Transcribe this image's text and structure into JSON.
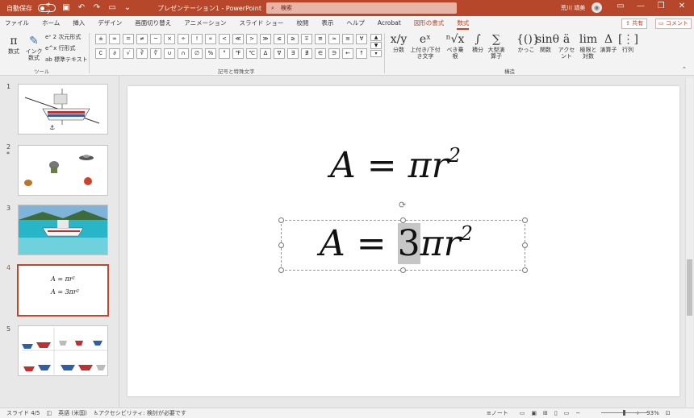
{
  "titlebar": {
    "autosave_label": "自動保存",
    "autosave_state": "オフ",
    "doc_title": "プレゼンテーション1 - PowerPoint",
    "search_placeholder": "検索",
    "user_name": "荒川 靖美",
    "accent_color": "#b7472a"
  },
  "menu": {
    "tabs": [
      "ファイル",
      "ホーム",
      "挿入",
      "デザイン",
      "画面切り替え",
      "アニメーション",
      "スライド ショー",
      "校閲",
      "表示",
      "ヘルプ",
      "Acrobat",
      "図形の書式",
      "数式"
    ],
    "active_tab": "数式",
    "share_label": "共有",
    "comment_label": "コメント"
  },
  "ribbon": {
    "tools": {
      "equation": "数式",
      "ink": "インク数式",
      "linear_2d": "2 次元形式",
      "linear": "行形式",
      "text": "標準テキスト",
      "group_label": "ツール"
    },
    "symbols": {
      "row1": [
        "±",
        "∞",
        "=",
        "≠",
        "~",
        "×",
        "÷",
        "!",
        "∝",
        "<",
        "≪",
        ">",
        "≫",
        "≤",
        "≥",
        "∓",
        "≅",
        "≈",
        "≡",
        "∀"
      ],
      "row2": [
        "∁",
        "∂",
        "√",
        "∛",
        "∜",
        "∪",
        "∩",
        "∅",
        "%",
        "°",
        "℉",
        "℃",
        "∆",
        "∇",
        "∃",
        "∄",
        "∈",
        "∋",
        "←",
        "↑"
      ],
      "group_label": "記号と特殊文字"
    },
    "structures": {
      "items": [
        {
          "glyph": "x/y",
          "label": "分数"
        },
        {
          "glyph": "eˣ",
          "label": "上付き/下付き文字"
        },
        {
          "glyph": "ⁿ√x",
          "label": "べき乗根"
        },
        {
          "glyph": "∫",
          "label": "積分"
        },
        {
          "glyph": "∑",
          "label": "大型演算子"
        },
        {
          "glyph": "{()}",
          "label": "かっこ"
        },
        {
          "glyph": "sinθ",
          "label": "関数"
        },
        {
          "glyph": "ä",
          "label": "アクセント"
        },
        {
          "glyph": "lim",
          "label": "極限と対数"
        },
        {
          "glyph": "Δ",
          "label": "演算子"
        },
        {
          "glyph": "[⋮]",
          "label": "行列"
        }
      ],
      "group_label": "構造"
    }
  },
  "slides": [
    {
      "num": "1",
      "desc": "boat"
    },
    {
      "num": "2",
      "star": "*",
      "desc": "icons"
    },
    {
      "num": "3",
      "desc": "sea"
    },
    {
      "num": "4",
      "desc": "equations",
      "line1": "A = πr²",
      "line2": "A = 3πr²"
    },
    {
      "num": "5",
      "desc": "boats"
    }
  ],
  "canvas": {
    "eq1": {
      "a": "A",
      "eq": "=",
      "pi": "πr",
      "exp": "2"
    },
    "eq2": {
      "a": "A",
      "eq": "=",
      "highlight": "3",
      "pi": "πr",
      "exp": "2"
    }
  },
  "status": {
    "slide": "スライド 4/5",
    "language": "英語 (米国)",
    "accessibility": "アクセシビリティ: 検討が必要です",
    "notes": "ノート",
    "zoom": "93%"
  }
}
